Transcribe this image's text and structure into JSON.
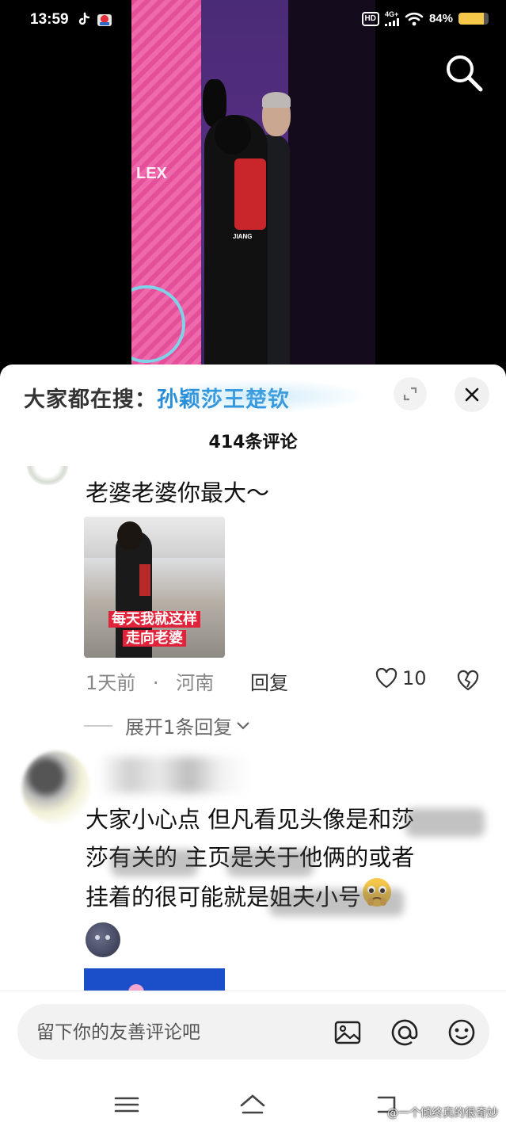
{
  "status_bar": {
    "time": "13:59",
    "hd": "HD",
    "network": "4G+",
    "battery_percent_label": "84%",
    "battery_level": 0.84,
    "app_icons": [
      "tiktok-icon",
      "game-icon"
    ]
  },
  "video": {
    "banner_text": "LEX",
    "watermark": "JIANG"
  },
  "sheet": {
    "search_prefix": "大家都在搜：",
    "search_term": "孙颖莎王楚钦",
    "comment_count": "414条评论"
  },
  "comments": [
    {
      "text": "老婆老婆你最大～",
      "image_caption_line1": "每天我就这样",
      "image_caption_line2": "走向老婆",
      "time": "1天前",
      "separator": "·",
      "location": "河南",
      "reply_label": "回复",
      "likes": "10",
      "expand_label": "展开1条回复"
    },
    {
      "line1": "大家小心点 但凡看见头像是和莎",
      "line2": "莎有关的 主页是关于他俩的或者",
      "line3": "挂着的很可能就是姐夫小号"
    }
  ],
  "input": {
    "placeholder": "留下你的友善评论吧"
  },
  "watermark": "@一个倾终真的很奇妙",
  "colors": {
    "accent_blue": "#2a8fd9",
    "caption_red": "#e0233a",
    "battery_yellow": "#f5c84a"
  }
}
